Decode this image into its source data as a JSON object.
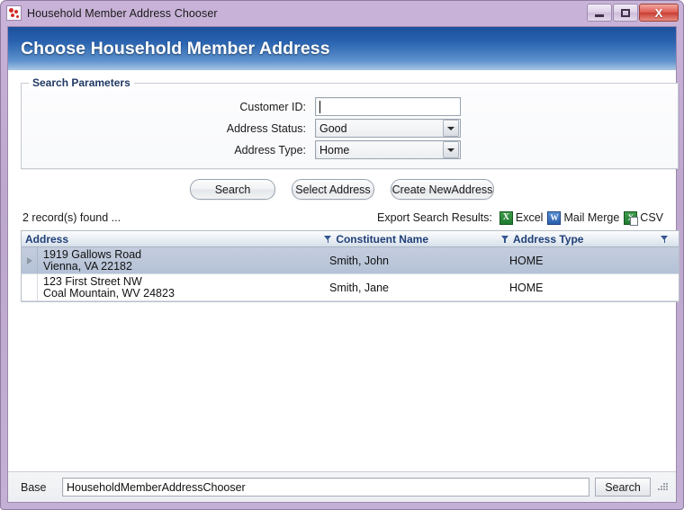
{
  "window": {
    "title": "Household Member Address Chooser",
    "icon": "app-dots-icon",
    "buttons": {
      "minimize": "minimize-icon",
      "maximize": "maximize-icon",
      "close": "X"
    }
  },
  "header": {
    "title": "Choose Household Member Address",
    "accent": "#1c4f9c"
  },
  "search_panel": {
    "legend": "Search Parameters",
    "fields": [
      {
        "label": "Customer ID:",
        "type": "text",
        "value": "",
        "placeholder": ""
      },
      {
        "label": "Address Status:",
        "type": "combo",
        "value": "Good"
      },
      {
        "label": "Address Type:",
        "type": "combo",
        "value": "Home"
      }
    ]
  },
  "actions": {
    "search": "Search",
    "select_address": "Select Address",
    "create_new_address": "Create NewAddress"
  },
  "results": {
    "count_text": "2 record(s) found ...",
    "export_label": "Export Search Results:",
    "export_options": [
      {
        "label": "Excel",
        "icon": "excel-icon",
        "glyph": "X"
      },
      {
        "label": "Mail Merge",
        "icon": "word-icon",
        "glyph": "W"
      },
      {
        "label": "CSV",
        "icon": "csv-icon",
        "glyph": "X"
      }
    ]
  },
  "grid": {
    "columns": [
      {
        "label": "Address",
        "filter": true
      },
      {
        "label": "Constituent Name",
        "filter": true
      },
      {
        "label": "Address Type",
        "filter": true
      }
    ],
    "rows": [
      {
        "selected": true,
        "address_line1": "1919 Gallows Road",
        "address_line2": "Vienna, VA 22182",
        "constituent_name": "Smith, John",
        "address_type": "HOME"
      },
      {
        "selected": false,
        "address_line1": "123 First Street NW",
        "address_line2": "Coal Mountain, WV 24823",
        "constituent_name": "Smith, Jane",
        "address_type": "HOME"
      }
    ]
  },
  "statusbar": {
    "label": "Base",
    "value": "HouseholdMemberAddressChooser",
    "button": "Search"
  }
}
